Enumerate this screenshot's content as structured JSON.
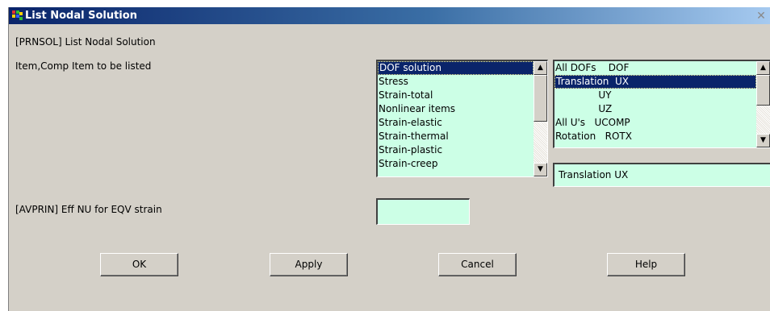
{
  "window": {
    "title": "List Nodal Solution",
    "close_symbol": "✕"
  },
  "header_label": "[PRNSOL] List Nodal Solution",
  "item_label": "Item,Comp   Item to be listed",
  "category_list": {
    "items": [
      "DOF solution",
      "Stress",
      "Strain-total",
      "Nonlinear items",
      "Strain-elastic",
      "Strain-thermal",
      "Strain-plastic",
      "Strain-creep"
    ],
    "selected": "DOF solution"
  },
  "component_list": {
    "items": [
      "All DOFs    DOF",
      "Translation  UX",
      "              UY",
      "              UZ",
      "All U's   UCOMP",
      "Rotation   ROTX"
    ],
    "selected": "Translation  UX"
  },
  "component_selected_value": "Translation  UX",
  "avprin_label": "[AVPRIN]  Eff NU for EQV strain",
  "avprin_value": "",
  "buttons": {
    "ok": "OK",
    "apply": "Apply",
    "cancel": "Cancel",
    "help": "Help"
  },
  "colors": {
    "field_bg": "#ccffe6",
    "dialog_bg": "#d4d0c8",
    "selection": "#0a246a",
    "title_start": "#0a246a",
    "title_end": "#a6caf0"
  },
  "icons": {
    "app": "ansys-app-icon",
    "close": "close-icon",
    "scroll_up": "scroll-up-arrow-icon",
    "scroll_down": "scroll-down-arrow-icon"
  }
}
